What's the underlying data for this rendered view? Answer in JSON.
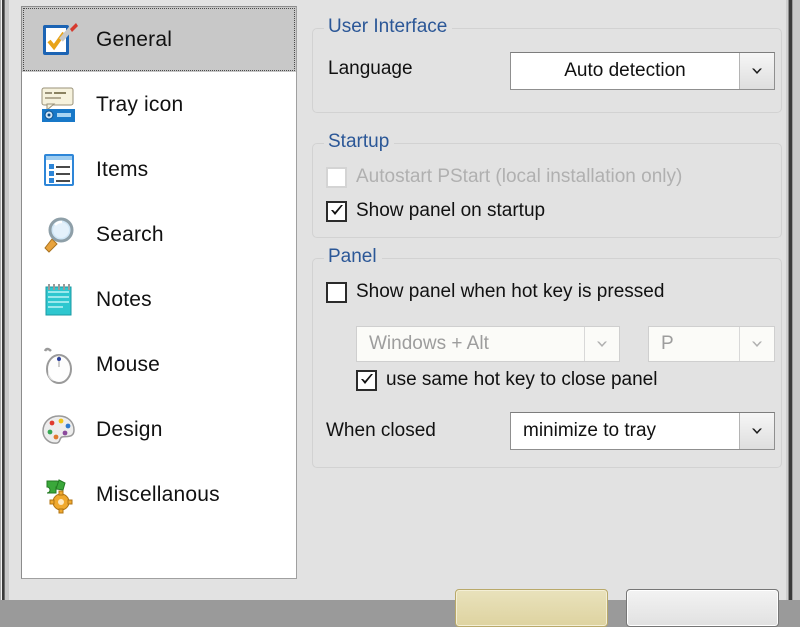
{
  "window": {
    "background_color": "#e2e2e2",
    "accent_color": "#2b5797"
  },
  "sidebar": {
    "items": [
      {
        "label": "General",
        "icon": "checklist-pencil-icon",
        "selected": true
      },
      {
        "label": "Tray icon",
        "icon": "tray-balloon-icon",
        "selected": false
      },
      {
        "label": "Items",
        "icon": "list-items-icon",
        "selected": false
      },
      {
        "label": "Search",
        "icon": "magnifier-icon",
        "selected": false
      },
      {
        "label": "Notes",
        "icon": "notepad-icon",
        "selected": false
      },
      {
        "label": "Mouse",
        "icon": "mouse-icon",
        "selected": false
      },
      {
        "label": "Design",
        "icon": "palette-icon",
        "selected": false
      },
      {
        "label": "Miscellanous",
        "icon": "puzzle-gear-icon",
        "selected": false
      }
    ]
  },
  "user_interface": {
    "title": "User Interface",
    "language_label": "Language",
    "language_value": "Auto detection",
    "language_arrow_icon": "chevron-down-icon"
  },
  "startup": {
    "title": "Startup",
    "autostart_label": "Autostart PStart (local installation only)",
    "autostart_checked": false,
    "autostart_enabled": false,
    "show_panel_label": "Show panel on startup",
    "show_panel_checked": true,
    "show_panel_enabled": true
  },
  "panel": {
    "title": "Panel",
    "hotkey_label": "Show panel when hot key is pressed",
    "hotkey_checked": false,
    "modifier_value": "Windows + Alt",
    "modifier_enabled": false,
    "modifier_arrow_icon": "chevron-down-icon",
    "key_value": "P",
    "key_enabled": false,
    "key_arrow_icon": "chevron-down-icon",
    "same_hotkey_label": "use same hot key to close panel",
    "same_hotkey_checked": true,
    "when_closed_label": "When closed",
    "when_closed_value": "minimize to tray",
    "when_closed_arrow_icon": "chevron-down-icon"
  },
  "footer": {
    "ok_label": "",
    "cancel_label": ""
  }
}
